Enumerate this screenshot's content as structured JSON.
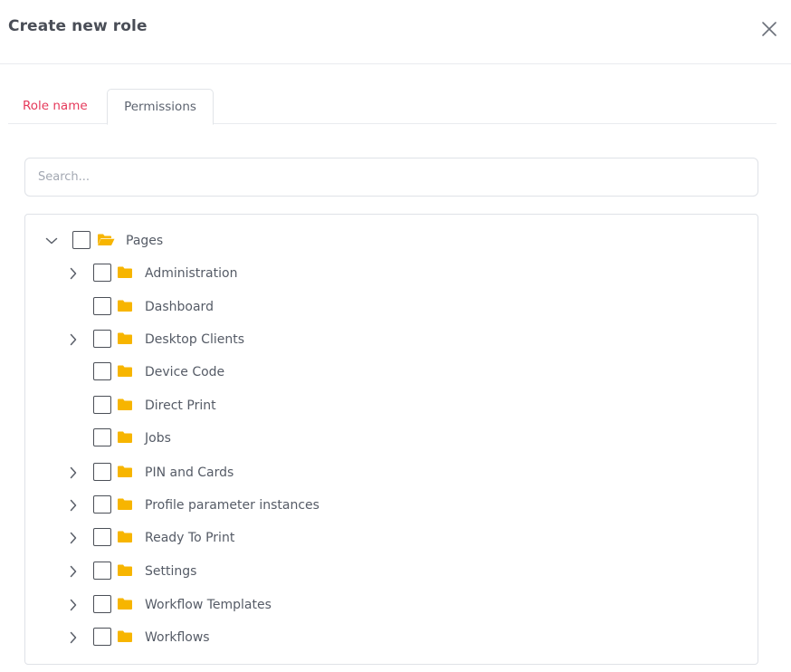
{
  "dialog": {
    "title": "Create new role"
  },
  "tabs": [
    {
      "label": "Role name"
    },
    {
      "label": "Permissions"
    }
  ],
  "search": {
    "placeholder": "Search...",
    "value": ""
  },
  "tree": {
    "root": {
      "label": "Pages",
      "expanded": true,
      "checked": false
    },
    "children": [
      {
        "label": "Administration",
        "expandable": true,
        "checked": false
      },
      {
        "label": "Dashboard",
        "expandable": false,
        "checked": false
      },
      {
        "label": "Desktop Clients",
        "expandable": true,
        "checked": false
      },
      {
        "label": "Device Code",
        "expandable": false,
        "checked": false
      },
      {
        "label": "Direct Print",
        "expandable": false,
        "checked": false
      },
      {
        "label": "Jobs",
        "expandable": false,
        "checked": false
      },
      {
        "label": "PIN and Cards",
        "expandable": true,
        "checked": false
      },
      {
        "label": "Profile parameter instances",
        "expandable": true,
        "checked": false
      },
      {
        "label": "Ready To Print",
        "expandable": true,
        "checked": false
      },
      {
        "label": "Settings",
        "expandable": true,
        "checked": false
      },
      {
        "label": "Workflow Templates",
        "expandable": true,
        "checked": false
      },
      {
        "label": "Workflows",
        "expandable": true,
        "checked": false
      }
    ]
  },
  "colors": {
    "accent": "#e5395a",
    "folder": "#f7b500",
    "text": "#555b66",
    "border": "#dfe2e7"
  },
  "icons": {
    "close": "close-icon",
    "expanded": "chevron-down-icon",
    "collapsed": "chevron-right-icon",
    "root_folder": "folder-open-icon",
    "folder": "folder-icon"
  }
}
